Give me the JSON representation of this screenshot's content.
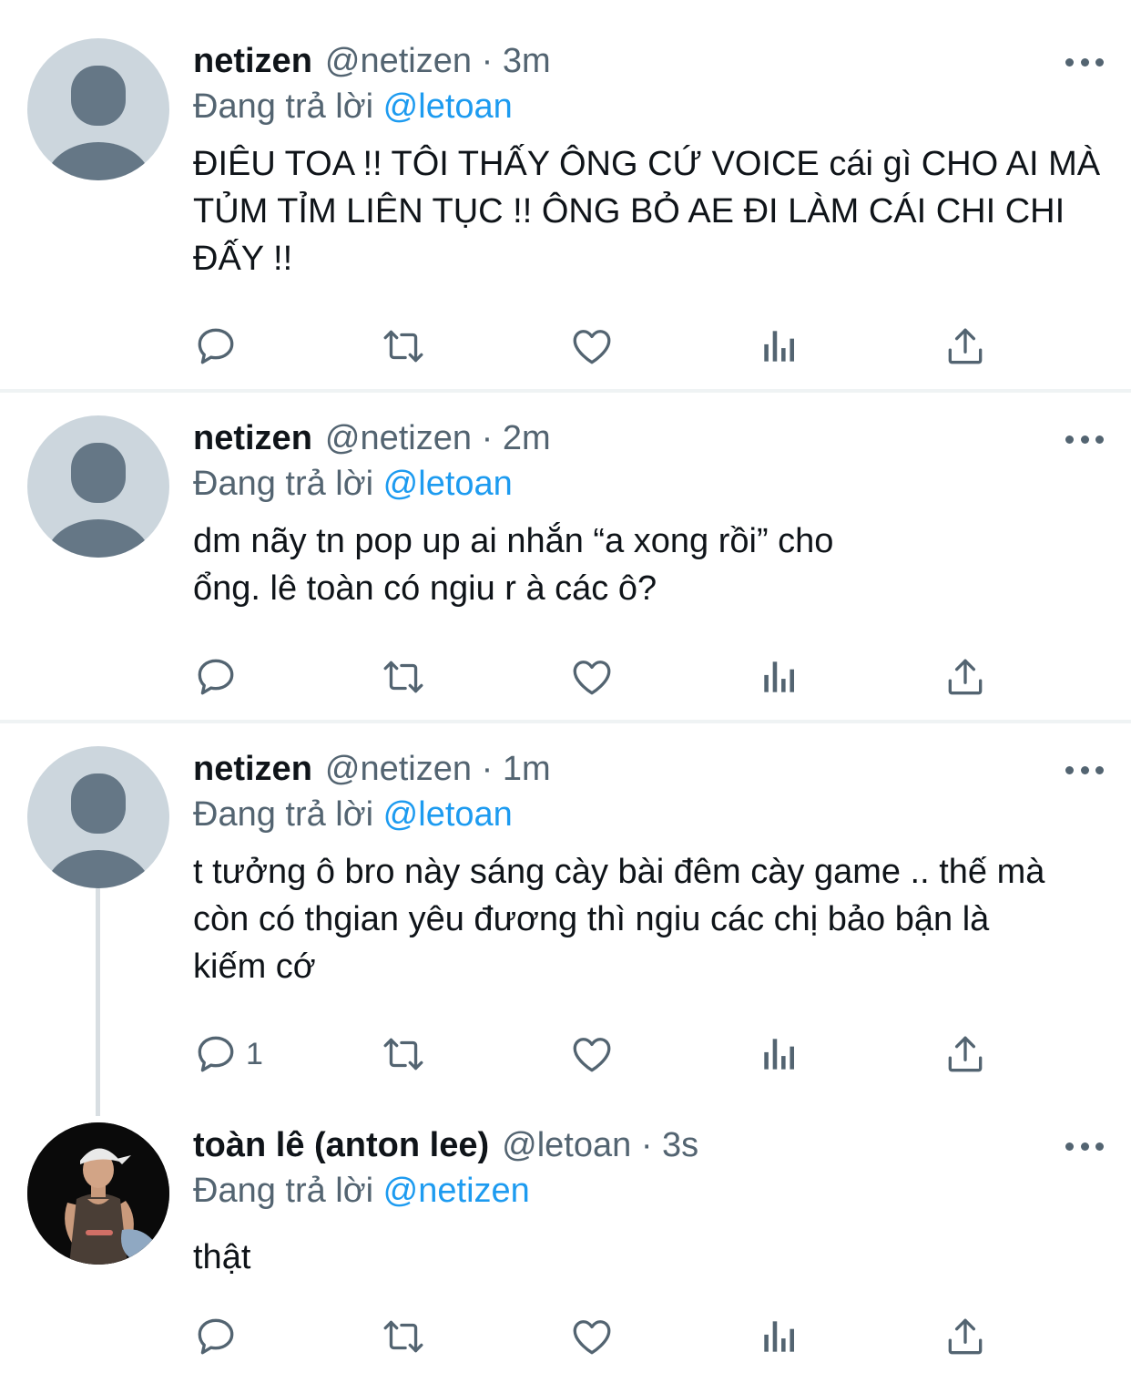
{
  "tweets": [
    {
      "name": "netizen",
      "handle": "@netizen",
      "time": "3m",
      "reply_prefix": "Đang trả lời",
      "reply_to": "@letoan",
      "text": "ĐIÊU TOA !! TÔI THẤY ÔNG CỨ VOICE cái gì CHO AI MÀ TỦM TỈM LIÊN TỤC !! ÔNG BỎ AE ĐI LÀM CÁI CHI CHI ĐẤY !!",
      "reply_count": ""
    },
    {
      "name": "netizen",
      "handle": "@netizen",
      "time": "2m",
      "reply_prefix": "Đang trả lời",
      "reply_to": "@letoan",
      "text": "dm nãy tn pop up ai nhắn “a xong rồi” cho ổng. lê toàn có ngiu r à các ô?",
      "reply_count": ""
    },
    {
      "name": "netizen",
      "handle": "@netizen",
      "time": "1m",
      "reply_prefix": "Đang trả lời",
      "reply_to": "@letoan",
      "text": "t tưởng ô bro này sáng cày bài đêm cày game .. thế mà còn có thgian yêu đương thì ngiu các chị bảo bận là kiếm cớ",
      "reply_count": "1"
    },
    {
      "name": "toàn lê (anton lee)",
      "handle": "@letoan",
      "time": "3s",
      "reply_prefix": "Đang trả lời",
      "reply_to": "@netizen",
      "text": "thật",
      "reply_count": ""
    }
  ],
  "separator": "·",
  "icons": {
    "reply": "reply-icon",
    "retweet": "retweet-icon",
    "like": "heart-icon",
    "views": "analytics-icon",
    "share": "share-icon",
    "more": "more-icon"
  },
  "colors": {
    "text": "#0f1419",
    "secondary": "#536471",
    "accent": "#1d9bf0",
    "divider": "#eff3f4",
    "avatar_bg": "#ccd6dd",
    "avatar_fg": "#657786"
  }
}
